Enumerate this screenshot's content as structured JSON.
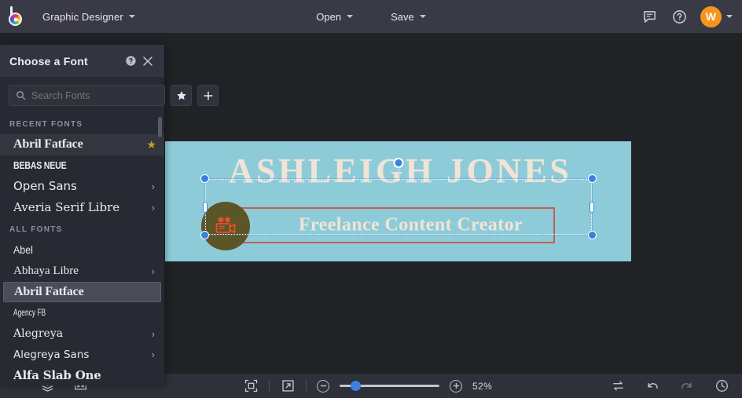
{
  "topbar": {
    "logo_icon": "color-wheel-logo",
    "document_title": "Graphic Designer",
    "menus": [
      {
        "label": "Open",
        "icon": "chevron-down-icon"
      },
      {
        "label": "Save",
        "icon": "chevron-down-icon"
      }
    ],
    "icons": [
      {
        "name": "comment-icon"
      },
      {
        "name": "help-circle-icon"
      }
    ],
    "avatar_initial": "W",
    "avatar_color": "#f5951f"
  },
  "font_panel": {
    "title": "Choose a Font",
    "help_icon": "help-circle-icon",
    "close_icon": "close-icon",
    "search": {
      "placeholder": "Search Fonts",
      "value": "",
      "icon": "search-icon"
    },
    "favorites_button": "star-icon",
    "add_button": "plus-icon",
    "recent_label": "RECENT FONTS",
    "recent_fonts": [
      {
        "label": "Abril Fatface",
        "face": "f-abril",
        "starred": true,
        "chevron": false,
        "active": true
      },
      {
        "label": "BEBAS NEUE",
        "face": "f-bebas",
        "starred": false,
        "chevron": false,
        "active": false
      },
      {
        "label": "Open Sans",
        "face": "f-opensans",
        "starred": false,
        "chevron": true,
        "active": false
      },
      {
        "label": "Averia Serif Libre",
        "face": "f-averia",
        "starred": false,
        "chevron": true,
        "active": false
      }
    ],
    "all_label": "ALL FONTS",
    "all_fonts": [
      {
        "label": "Abel",
        "face": "f-abel",
        "chevron": false,
        "selected": false
      },
      {
        "label": "Abhaya Libre",
        "face": "f-abhaya",
        "chevron": true,
        "selected": false
      },
      {
        "label": "Abril Fatface",
        "face": "f-abril",
        "chevron": false,
        "selected": true
      },
      {
        "label": "Agency FB",
        "face": "f-agency",
        "chevron": false,
        "selected": false
      },
      {
        "label": "Alegreya",
        "face": "f-alegreya",
        "chevron": true,
        "selected": false
      },
      {
        "label": "Alegreya Sans",
        "face": "f-alegreyasans",
        "chevron": true,
        "selected": false
      },
      {
        "label": "Alfa Slab One",
        "face": "f-alfaslab",
        "chevron": false,
        "selected": false
      }
    ]
  },
  "canvas": {
    "background_color": "#8ecbd9",
    "title_text": "ASHLEIGH JONES",
    "title_color": "#f0e4d7",
    "subtitle_text": "Freelance Content Creator",
    "subtitle_border_color": "#c4604f",
    "badge_icon": "movie-camera-icon",
    "badge_background": "#5c5526",
    "badge_icon_color": "#e8502e",
    "selection": {
      "handle_color": "#3b82e0",
      "rotate_handle": "rotate-handle"
    }
  },
  "bottombar": {
    "left_icons": [
      {
        "name": "layers-icon"
      },
      {
        "name": "panels-icon"
      }
    ],
    "fit_icon": "fit-to-screen-icon",
    "expand_icon": "expand-icon",
    "zoom_out_icon": "minus-icon",
    "zoom_in_icon": "plus-icon",
    "zoom_level": "52%",
    "zoom_slider_percent": 12,
    "right_icons": [
      {
        "name": "swap-icon",
        "dim": false
      },
      {
        "name": "undo-icon",
        "dim": false
      },
      {
        "name": "redo-icon",
        "dim": true
      },
      {
        "name": "history-clock-icon",
        "dim": false
      }
    ]
  }
}
